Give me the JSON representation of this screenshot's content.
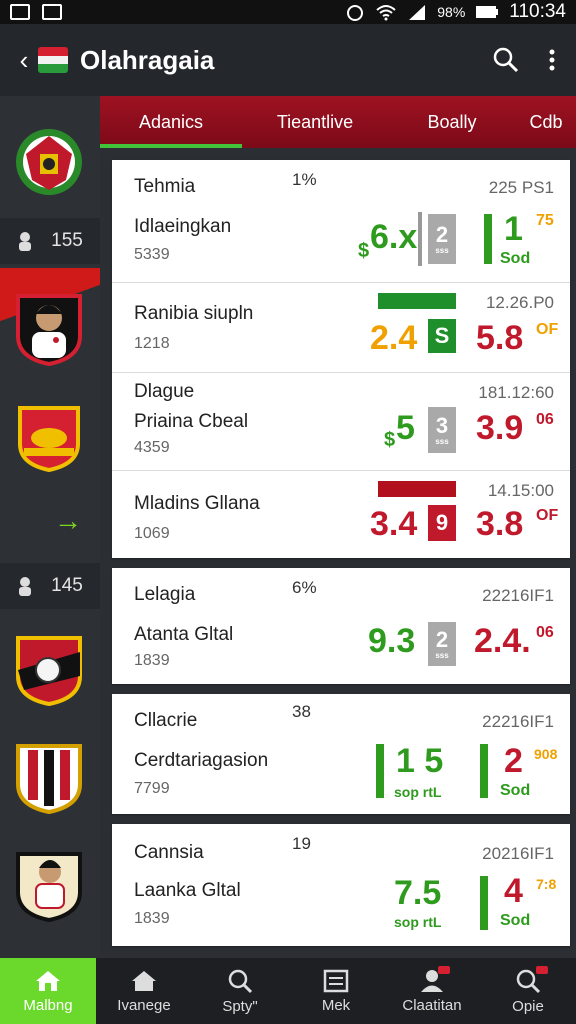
{
  "status": {
    "signal_text": "98%",
    "time": "110:34"
  },
  "appbar": {
    "title": "Olahragaia",
    "back_icon": "back-arrow-icon",
    "search_icon": "search-icon",
    "menu_icon": "more-vert-icon"
  },
  "tabs": [
    "Adanics",
    "Tieantlive",
    "Boally",
    "Cdb"
  ],
  "sidebar": {
    "counts": [
      "155",
      "145"
    ],
    "logos": [
      "garuda-crest",
      "player-shield",
      "red-crest",
      "ball-shield",
      "striped-shield",
      "player-shield-2"
    ]
  },
  "cards": [
    {
      "rows": [
        {
          "league": "Tehmia",
          "mid": "1%",
          "right": "225 PS1",
          "team": "Idlaeingkan",
          "sub": "5339",
          "odd1_prefix": "$",
          "odd1": "6.x",
          "box": "2",
          "box_sub": "sss",
          "box_color": "#a9a9a9",
          "bar_val": "1",
          "bar_sup": "75",
          "bar_sub": "Sod"
        },
        {
          "league": "",
          "mid": "",
          "right": "12.26.P0",
          "team": "Ranibia siupln",
          "sub": "1218",
          "odd1": "2.4",
          "box": "S",
          "box_color": "#1e8f2a",
          "odd2": "5.8",
          "odd2_sup": "OF"
        },
        {
          "league": "Dlague",
          "mid": "",
          "right": "181.12:60",
          "team": "Priaina Cbeal",
          "sub": "4359",
          "odd1_prefix": "$",
          "odd1": "5",
          "box": "3",
          "box_sub": "sss",
          "box_color": "#a9a9a9",
          "odd2": "3.9",
          "odd2_sup": "06"
        },
        {
          "league": "",
          "mid": "",
          "right": "14.15:00",
          "team": "Mladins Gllana",
          "sub": "1069",
          "odd1": "3.4",
          "box": "9",
          "box_color": "#c0192c",
          "odd2": "3.8",
          "odd2_sup": "OF"
        }
      ]
    },
    {
      "rows": [
        {
          "league": "Lelagia",
          "mid": "6%",
          "right": "22216IF1",
          "team": "Atanta Gltal",
          "sub": "1839",
          "odd1": "9.3",
          "box": "2",
          "box_sub": "sss",
          "box_color": "#a9a9a9",
          "odd2": "2.4.",
          "odd2_sup": "06"
        }
      ]
    },
    {
      "rows": [
        {
          "league": "Cllacrie",
          "mid": "38",
          "right": "22216IF1",
          "team": "Cerdtariagasion",
          "sub": "7799",
          "odd1": "1 5",
          "odd1_sub": "sop rtL",
          "odd2": "2",
          "odd2_sup": "908",
          "odd2_sub": "Sod"
        }
      ]
    },
    {
      "rows": [
        {
          "league": "Cannsia",
          "mid": "19",
          "right": "20216IF1",
          "team": "Laanka Gltal",
          "sub": "1839",
          "odd1": "7.5",
          "odd1_sub": "sop rtL",
          "odd2": "4",
          "odd2_sup": "7:8",
          "odd2_sub": "Sod"
        }
      ]
    }
  ],
  "bottomnav": [
    {
      "label": "Malbng",
      "icon": "home-icon",
      "active": true
    },
    {
      "label": "Ivanege",
      "icon": "house-icon",
      "active": false
    },
    {
      "label": "Spty\"",
      "icon": "search-icon",
      "active": false
    },
    {
      "label": "Mek",
      "icon": "list-icon",
      "active": false
    },
    {
      "label": "Claatitan",
      "icon": "profile-icon",
      "active": false
    },
    {
      "label": "Opie",
      "icon": "search-badge-icon",
      "active": false
    }
  ],
  "colors": {
    "accent_green": "#6bd92c",
    "tab_red": "#9e1222",
    "odd_green": "#2e9b1e",
    "odd_red": "#c0192c",
    "odd_orange": "#f0a000"
  }
}
